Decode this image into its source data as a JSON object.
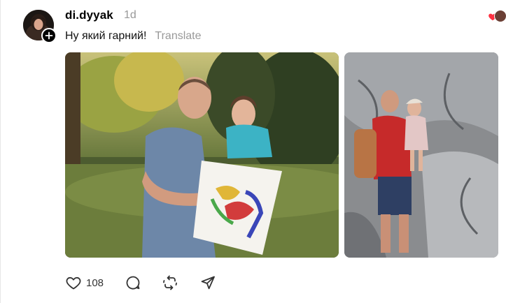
{
  "post": {
    "username": "di.dyyak",
    "time": "1d",
    "caption": "Ну який гарний!",
    "translate_label": "Translate",
    "like_count": "108"
  },
  "icons": {
    "like": "heart-icon",
    "comment": "comment-icon",
    "repost": "repost-icon",
    "share": "send-icon",
    "follow": "plus-icon"
  },
  "colors": {
    "like_heart": "#ff3040",
    "muted_text": "#999999"
  }
}
